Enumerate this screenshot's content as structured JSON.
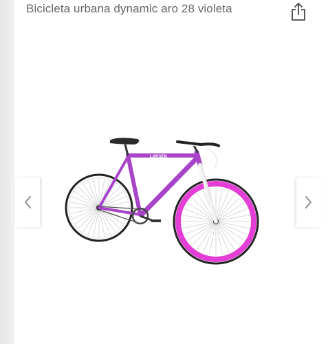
{
  "product": {
    "title": "Bicicleta urbana dynamic aro 28 violeta",
    "brand_decal": "LARSEN"
  },
  "actions": {
    "share_icon": "share-icon",
    "prev_icon": "chevron-left-icon",
    "next_icon": "chevron-right-icon"
  },
  "colors": {
    "frame": "#a844c8",
    "front_rim": "#e33ed6",
    "title_text": "#666666",
    "arrow": "#9a9a9a"
  }
}
